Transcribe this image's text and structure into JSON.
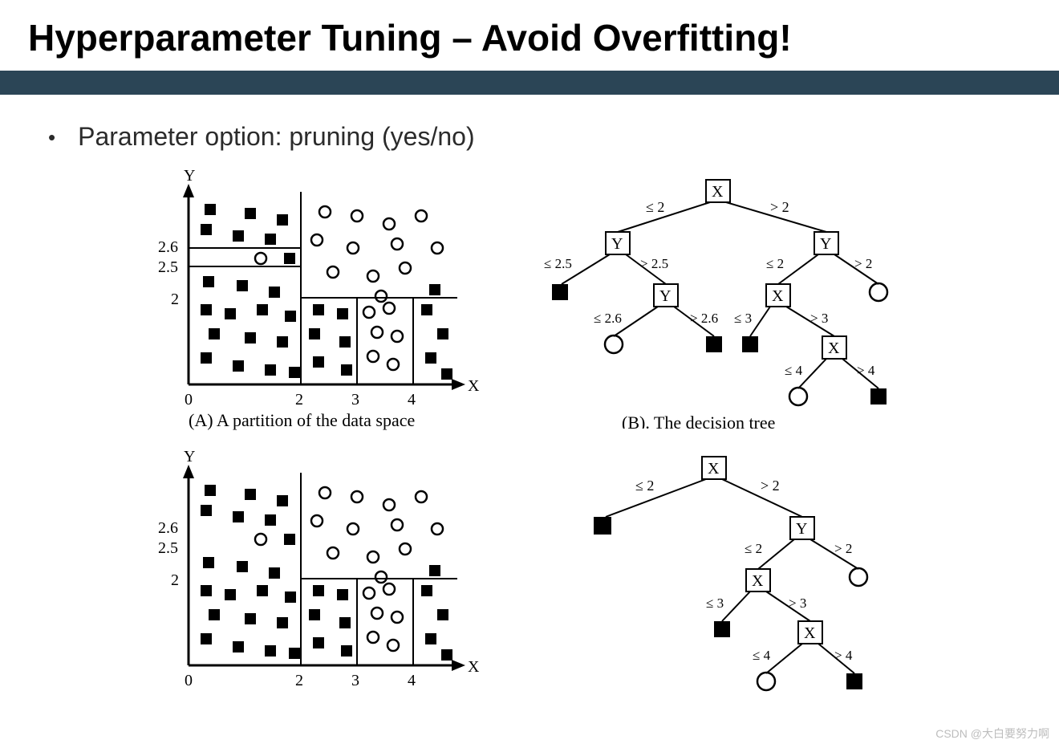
{
  "title": "Hyperparameter Tuning – Avoid Overfitting!",
  "bullet": "Parameter option: pruning (yes/no)",
  "captionA": "(A) A partition of the data space",
  "captionB": "(B). The decision tree",
  "axis_x": "X",
  "axis_y": "Y",
  "y_ticks": {
    "t0": "0",
    "t2": "2",
    "t25": "2.5",
    "t26": "2.6"
  },
  "x_ticks": {
    "x0": "0",
    "x2": "2",
    "x3": "3",
    "x4": "4"
  },
  "tree1": {
    "n1": "X",
    "n1l": "≤ 2",
    "n1r": "> 2",
    "n2": "Y",
    "n2l": "≤ 2.5",
    "n2r": "> 2.5",
    "n3": "Y",
    "n3l": "≤ 2",
    "n3r": "> 2",
    "n4": "Y",
    "n4l": "≤ 2.6",
    "n4r": "> 2.6",
    "n5": "X",
    "n5l": "≤ 3",
    "n5r": "> 3",
    "n6": "X",
    "n6l": "≤ 4",
    "n6r": "> 4"
  },
  "tree2": {
    "n1": "X",
    "n1l": "≤ 2",
    "n1r": "> 2",
    "n3": "Y",
    "n3l": "≤ 2",
    "n3r": "> 2",
    "n5": "X",
    "n5l": "≤ 3",
    "n5r": "> 3",
    "n6": "X",
    "n6l": "≤ 4",
    "n6r": "> 4"
  },
  "watermark": "CSDN @大白要努力啊"
}
